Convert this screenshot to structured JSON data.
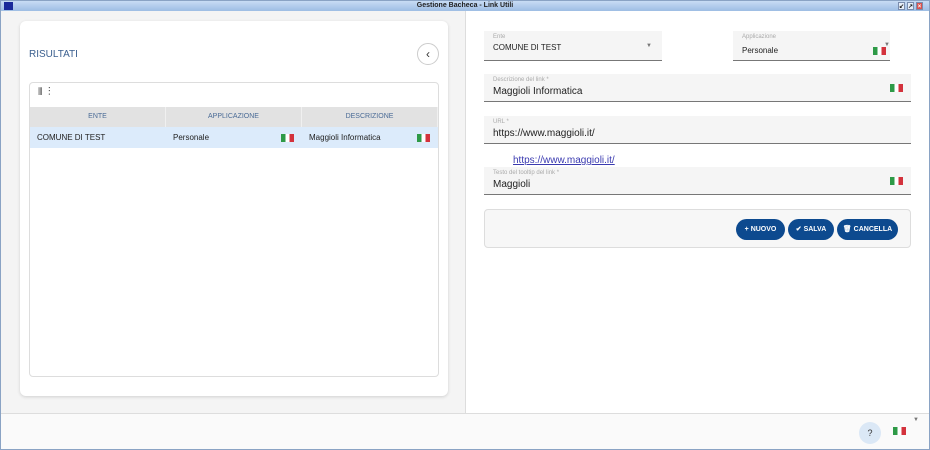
{
  "window": {
    "title": "Gestione Bacheca - Link Utili"
  },
  "left": {
    "title": "RISULTATI",
    "back_icon": "‹",
    "grid": {
      "columns": [
        "ENTE",
        "APPLICAZIONE",
        "DESCRIZIONE"
      ],
      "rows": [
        {
          "ente": "COMUNE DI TEST",
          "applicazione": "Personale",
          "descrizione": "Maggioli Informatica"
        }
      ]
    }
  },
  "form": {
    "ente": {
      "label": "Ente",
      "value": "COMUNE DI TEST"
    },
    "applicazione": {
      "label": "Applicazione",
      "value": "Personale"
    },
    "descrizione": {
      "label": "Descrizione del link *",
      "value": "Maggioli Informatica"
    },
    "url": {
      "label": "URL *",
      "value": "https://www.maggioli.it/"
    },
    "link_preview": "https://www.maggioli.it/",
    "tooltip": {
      "label": "Testo del tooltip del link *",
      "value": "Maggioli"
    },
    "buttons": {
      "nuovo": "NUOVO",
      "salva": "SALVA",
      "cancella": "CANCELLA"
    }
  },
  "footer": {
    "help": "?"
  },
  "colors": {
    "primary": "#0d4a8f",
    "selected_row": "#dcebfb"
  }
}
